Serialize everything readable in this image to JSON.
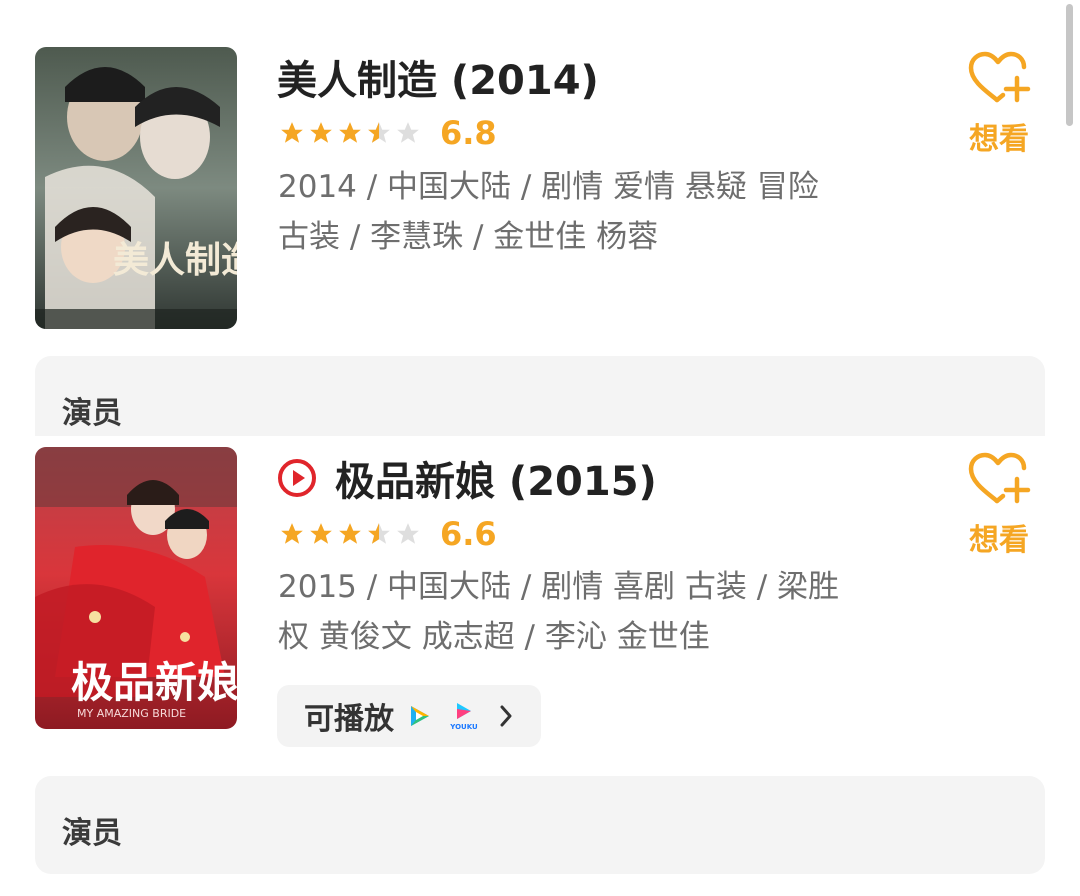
{
  "movies": [
    {
      "title": "美人制造 (2014)",
      "score": "6.8",
      "rating_stars": 3.5,
      "info_line1": "2014 / 中国大陆 / 剧情 爱情 悬疑 冒险",
      "info_line2": "古装 / 李慧珠 / 金世佳 杨蓉",
      "want_label": "想看",
      "poster_text": "美人制造"
    },
    {
      "title": "极品新娘 (2015)",
      "score": "6.6",
      "rating_stars": 3.5,
      "info_line1": "2015 / 中国大陆 / 剧情 喜剧 古装 / 梁胜",
      "info_line2": "权 黄俊文 成志超 / 李沁 金世佳",
      "want_label": "想看",
      "poster_text": "极品新娘",
      "poster_subtext": "MY AMAZING BRIDE",
      "playable": {
        "label": "可播放",
        "sources": [
          "tencent-video-icon",
          "youku-icon"
        ],
        "youku_text": "YOUKU"
      }
    }
  ],
  "cast_sections": [
    {
      "label": "演员"
    },
    {
      "label": "演员"
    }
  ],
  "colors": {
    "accent": "#f5a623",
    "title": "#222222",
    "info": "#6e6e6e",
    "card_bg": "#f4f4f4",
    "play_red": "#e0252b"
  }
}
